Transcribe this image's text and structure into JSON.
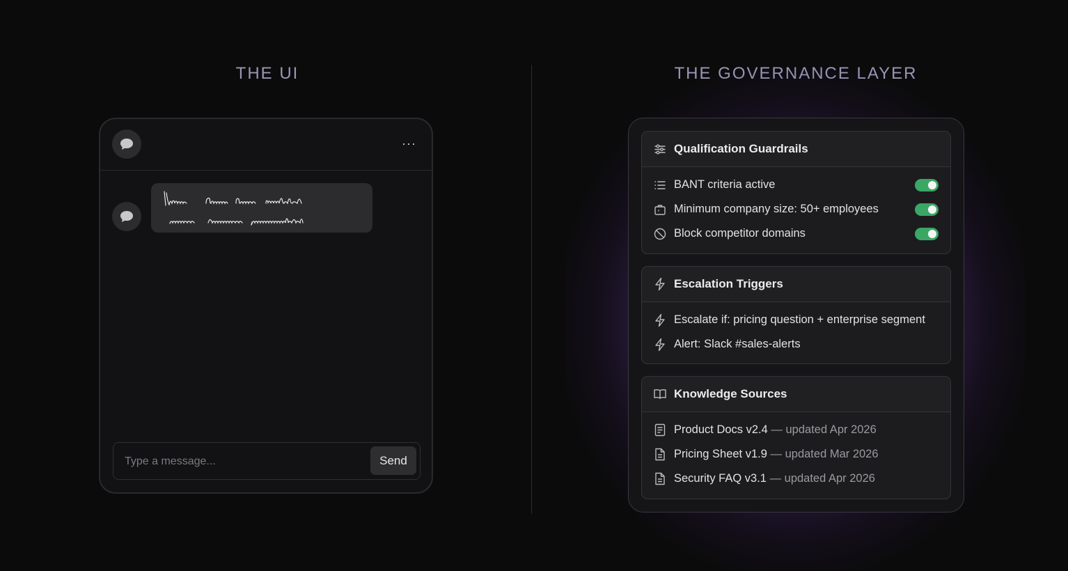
{
  "headings": {
    "left": "THE UI",
    "right": "THE GOVERNANCE LAYER"
  },
  "chat": {
    "menu_label": "···",
    "input_placeholder": "Type a message...",
    "send_label": "Send"
  },
  "governance": {
    "guardrails": {
      "title": "Qualification Guardrails",
      "items": [
        {
          "label": "BANT criteria active",
          "icon": "list-icon",
          "enabled": true
        },
        {
          "label": "Minimum company size: 50+ employees",
          "icon": "briefcase-icon",
          "enabled": true
        },
        {
          "label": "Block competitor domains",
          "icon": "block-icon",
          "enabled": true
        }
      ]
    },
    "escalation": {
      "title": "Escalation Triggers",
      "items": [
        {
          "label": "Escalate if: pricing question + enterprise segment",
          "icon": "lightning-icon"
        },
        {
          "label": "Alert: Slack #sales-alerts",
          "icon": "lightning-icon"
        }
      ]
    },
    "knowledge": {
      "title": "Knowledge Sources",
      "items": [
        {
          "name": "Product Docs v2.4",
          "meta": "— updated Apr 2026",
          "icon": "document-icon"
        },
        {
          "name": "Pricing Sheet v1.9",
          "meta": "— updated Mar 2026",
          "icon": "file-icon"
        },
        {
          "name": "Security FAQ v3.1",
          "meta": "— updated Apr 2026",
          "icon": "file-icon"
        }
      ]
    }
  },
  "colors": {
    "toggle_on": "#3aa765",
    "heading": "#9a96b6",
    "glow": "#a86edc"
  }
}
